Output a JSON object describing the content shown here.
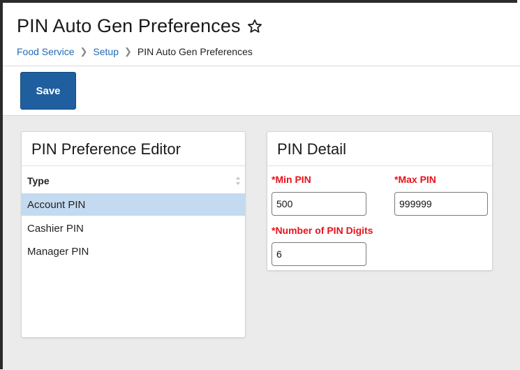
{
  "header": {
    "title": "PIN Auto Gen Preferences",
    "breadcrumb": [
      {
        "label": "Food Service"
      },
      {
        "label": "Setup"
      },
      {
        "label": "PIN Auto Gen Preferences"
      }
    ]
  },
  "toolbar": {
    "save_label": "Save"
  },
  "editor": {
    "title": "PIN Preference Editor",
    "column_header": "Type",
    "items": [
      {
        "label": "Account PIN",
        "selected": true
      },
      {
        "label": "Cashier PIN",
        "selected": false
      },
      {
        "label": "Manager PIN",
        "selected": false
      }
    ]
  },
  "detail": {
    "title": "PIN Detail",
    "min_pin": {
      "label": "*Min PIN",
      "value": "500"
    },
    "max_pin": {
      "label": "*Max PIN",
      "value": "999999"
    },
    "num_digits": {
      "label": "*Number of PIN Digits",
      "value": "6"
    }
  },
  "colors": {
    "accent": "#1f5f9f",
    "link": "#1e6bb8",
    "required_label": "#e8121a",
    "selected_row": "#c3daf0",
    "workarea_bg": "#ebebeb"
  },
  "icons": [
    "star-outline-icon",
    "chevron-right-icon",
    "sort-icon"
  ]
}
